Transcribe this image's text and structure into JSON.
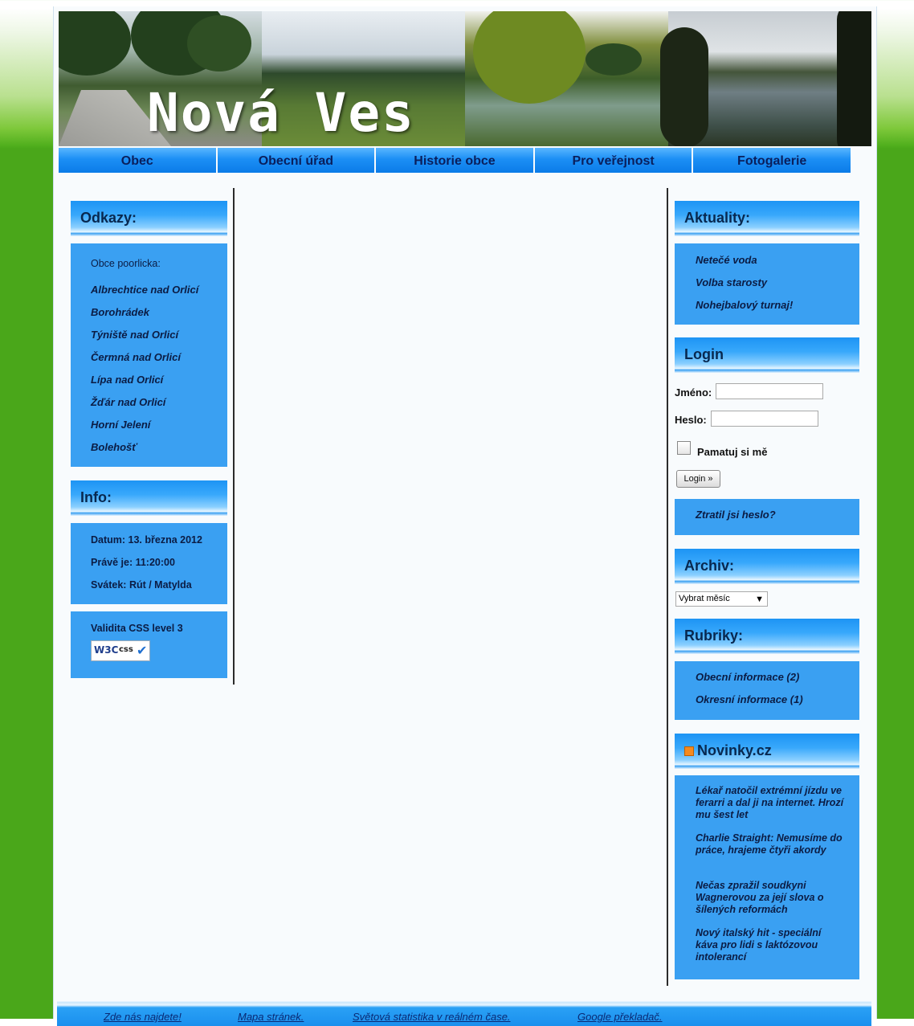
{
  "site": {
    "title": "Nová Ves"
  },
  "nav": [
    "Obec",
    "Obecní úřad",
    "Historie obce",
    "Pro veřejnost",
    "Fotogalerie"
  ],
  "left": {
    "odkazy": {
      "heading": "Odkazy:",
      "group_label": "Obce poorlicka:",
      "links": [
        "Albrechtice nad Orlicí",
        "Borohrádek",
        "Týniště nad Orlicí",
        "Čermná nad Orlicí",
        "Lípa nad Orlicí",
        "Žďár nad Orlicí",
        "Horní Jelení",
        "Bolehošť"
      ]
    },
    "info": {
      "heading": "Info:",
      "date": "Datum: 13. března 2012",
      "time": "Právě je: 11:20:00",
      "svatek": "Svátek: Rút / Matylda"
    },
    "validity": {
      "label": "Validita CSS level 3",
      "badge_w3c": "W3C",
      "badge_css": "css"
    }
  },
  "right": {
    "aktuality": {
      "heading": "Aktuality:",
      "items": [
        "Netečé voda",
        "Volba starosty",
        "Nohejbalový turnaj!"
      ]
    },
    "login": {
      "heading": "Login",
      "name_label": "Jméno:",
      "pass_label": "Heslo:",
      "remember_label": "Pamatuj si mě",
      "button_label": "Login »",
      "forgot_label": "Ztratil jsi heslo?"
    },
    "archiv": {
      "heading": "Archiv:",
      "select_value": "Vybrat měsíc"
    },
    "rubriky": {
      "heading": "Rubriky:",
      "items": [
        "Obecní informace (2)",
        "Okresní informace (1)"
      ]
    },
    "novinky": {
      "heading": "Novinky.cz",
      "items": [
        "Lékař natočil extrémní jízdu ve ferarri a dal ji na internet. Hrozí mu šest let",
        "Charlie Straight: Nemusíme do práce, hrajeme čtyři akordy",
        "Nečas zpražil soudkyni Wagnerovou za její slova o šílených reformách",
        "Nový italský hit - speciální káva pro lidi s laktózovou intolerancí"
      ]
    }
  },
  "footer": {
    "links": [
      "Zde nás najdete!",
      "Mapa stránek.",
      "Světová statistika v reálném čase.",
      "Google překladač."
    ]
  },
  "colors": {
    "accent_blue": "#3aa0f2",
    "nav_blue": "#1c8ff5",
    "page_green": "#4aa71a",
    "text_dark": "#0b1c44"
  }
}
